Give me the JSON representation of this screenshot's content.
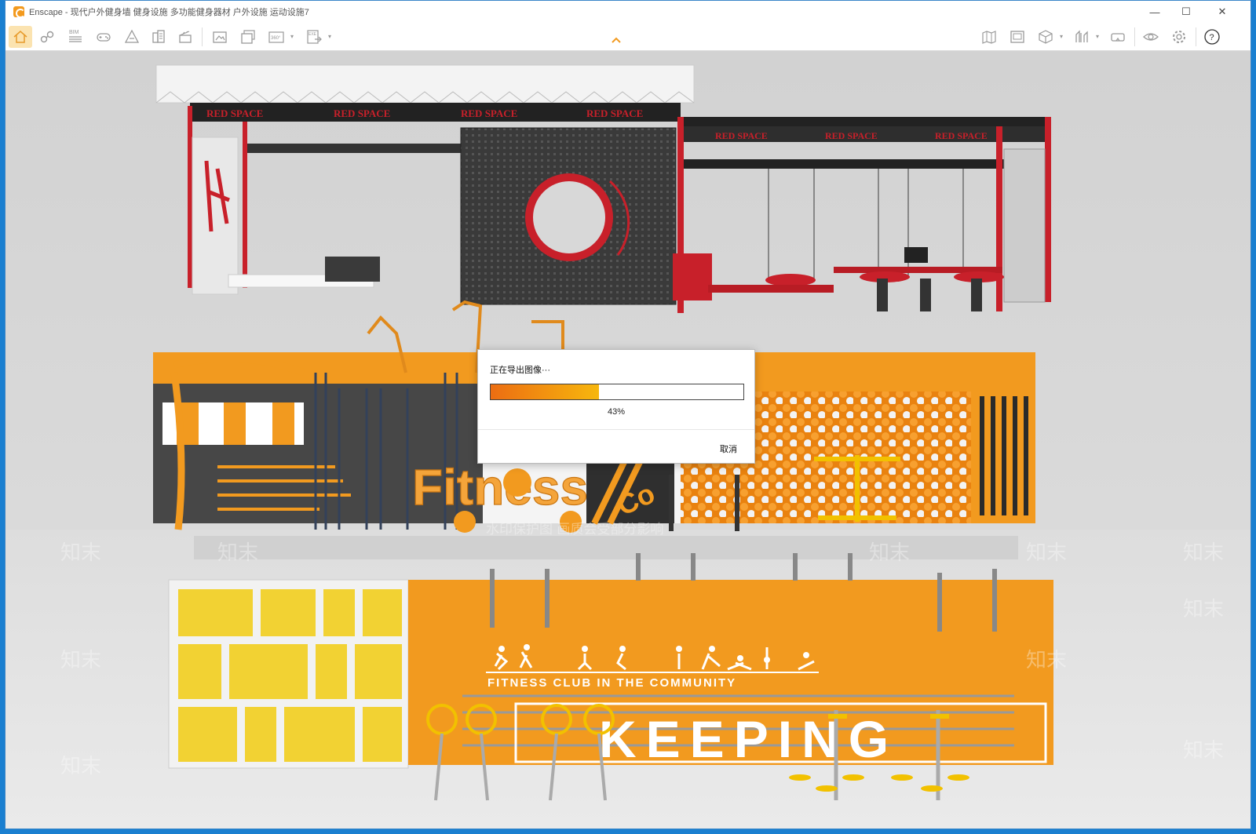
{
  "window": {
    "title": "Enscape - 现代户外健身墙 健身设施 多功能健身器材 户外设施 运动设施7",
    "controls": {
      "minimize": "—",
      "maximize": "☐",
      "close": "✕"
    }
  },
  "toolbar": {
    "left_tools": [
      {
        "icon": "home-icon",
        "active": true
      },
      {
        "icon": "link-icon"
      },
      {
        "icon": "bim-icon",
        "label": "BIM"
      },
      {
        "icon": "gamepad-icon"
      },
      {
        "icon": "site-icon"
      },
      {
        "icon": "building-icon"
      },
      {
        "icon": "clapper-icon"
      },
      {
        "icon": "screenshot-icon"
      },
      {
        "icon": "batch-render-icon"
      },
      {
        "icon": "panorama-icon",
        "label": "360°"
      },
      {
        "icon": "export-icon",
        "label": "EXE"
      }
    ],
    "right_tools": [
      {
        "icon": "map-icon"
      },
      {
        "icon": "image-view-icon"
      },
      {
        "icon": "cube-icon"
      },
      {
        "icon": "asset-library-icon"
      },
      {
        "icon": "vr-headset-icon"
      },
      {
        "icon": "visibility-icon"
      },
      {
        "icon": "settings-icon"
      },
      {
        "icon": "help-icon",
        "label": "?"
      }
    ]
  },
  "scene": {
    "signage_top": [
      "RED SPACE",
      "RED SPACE",
      "RED SPACE",
      "RED SPACE"
    ],
    "signage_right": [
      "RED SPACE",
      "RED SPACE",
      "RED SPACE"
    ],
    "fitness_text": "Fitness",
    "co_text": "Co",
    "club_caption": "Fitness Club in the Community",
    "keeping_text": "KEEPING",
    "watermark": "知末",
    "watermark_notice": "水印保护图 画质会受部分影响",
    "accent_orange": "#f29a1f",
    "accent_red": "#c8202a",
    "accent_yellow": "#f2d233"
  },
  "dialog": {
    "title": "正在导出图像···",
    "progress": 0.43,
    "percent_label": "43%",
    "cancel_label": "取消"
  }
}
